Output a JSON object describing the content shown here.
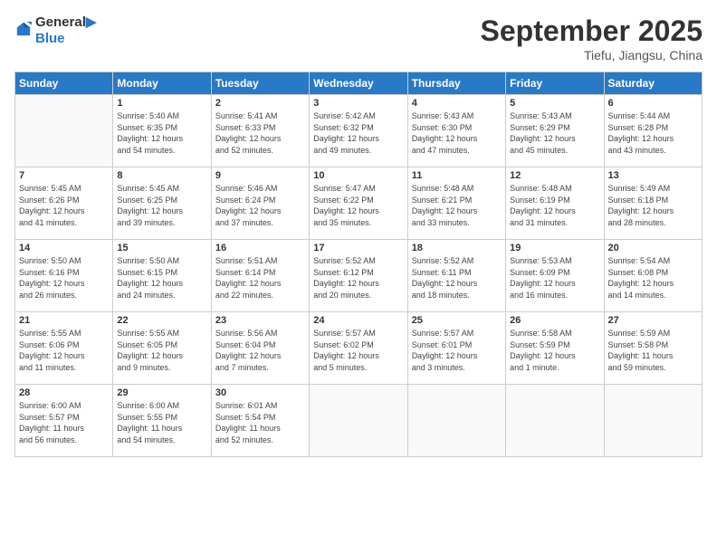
{
  "logo": {
    "line1": "General",
    "line2": "Blue"
  },
  "title": "September 2025",
  "subtitle": "Tiefu, Jiangsu, China",
  "weekdays": [
    "Sunday",
    "Monday",
    "Tuesday",
    "Wednesday",
    "Thursday",
    "Friday",
    "Saturday"
  ],
  "weeks": [
    [
      {
        "day": "",
        "info": ""
      },
      {
        "day": "1",
        "info": "Sunrise: 5:40 AM\nSunset: 6:35 PM\nDaylight: 12 hours\nand 54 minutes."
      },
      {
        "day": "2",
        "info": "Sunrise: 5:41 AM\nSunset: 6:33 PM\nDaylight: 12 hours\nand 52 minutes."
      },
      {
        "day": "3",
        "info": "Sunrise: 5:42 AM\nSunset: 6:32 PM\nDaylight: 12 hours\nand 49 minutes."
      },
      {
        "day": "4",
        "info": "Sunrise: 5:43 AM\nSunset: 6:30 PM\nDaylight: 12 hours\nand 47 minutes."
      },
      {
        "day": "5",
        "info": "Sunrise: 5:43 AM\nSunset: 6:29 PM\nDaylight: 12 hours\nand 45 minutes."
      },
      {
        "day": "6",
        "info": "Sunrise: 5:44 AM\nSunset: 6:28 PM\nDaylight: 12 hours\nand 43 minutes."
      }
    ],
    [
      {
        "day": "7",
        "info": "Sunrise: 5:45 AM\nSunset: 6:26 PM\nDaylight: 12 hours\nand 41 minutes."
      },
      {
        "day": "8",
        "info": "Sunrise: 5:45 AM\nSunset: 6:25 PM\nDaylight: 12 hours\nand 39 minutes."
      },
      {
        "day": "9",
        "info": "Sunrise: 5:46 AM\nSunset: 6:24 PM\nDaylight: 12 hours\nand 37 minutes."
      },
      {
        "day": "10",
        "info": "Sunrise: 5:47 AM\nSunset: 6:22 PM\nDaylight: 12 hours\nand 35 minutes."
      },
      {
        "day": "11",
        "info": "Sunrise: 5:48 AM\nSunset: 6:21 PM\nDaylight: 12 hours\nand 33 minutes."
      },
      {
        "day": "12",
        "info": "Sunrise: 5:48 AM\nSunset: 6:19 PM\nDaylight: 12 hours\nand 31 minutes."
      },
      {
        "day": "13",
        "info": "Sunrise: 5:49 AM\nSunset: 6:18 PM\nDaylight: 12 hours\nand 28 minutes."
      }
    ],
    [
      {
        "day": "14",
        "info": "Sunrise: 5:50 AM\nSunset: 6:16 PM\nDaylight: 12 hours\nand 26 minutes."
      },
      {
        "day": "15",
        "info": "Sunrise: 5:50 AM\nSunset: 6:15 PM\nDaylight: 12 hours\nand 24 minutes."
      },
      {
        "day": "16",
        "info": "Sunrise: 5:51 AM\nSunset: 6:14 PM\nDaylight: 12 hours\nand 22 minutes."
      },
      {
        "day": "17",
        "info": "Sunrise: 5:52 AM\nSunset: 6:12 PM\nDaylight: 12 hours\nand 20 minutes."
      },
      {
        "day": "18",
        "info": "Sunrise: 5:52 AM\nSunset: 6:11 PM\nDaylight: 12 hours\nand 18 minutes."
      },
      {
        "day": "19",
        "info": "Sunrise: 5:53 AM\nSunset: 6:09 PM\nDaylight: 12 hours\nand 16 minutes."
      },
      {
        "day": "20",
        "info": "Sunrise: 5:54 AM\nSunset: 6:08 PM\nDaylight: 12 hours\nand 14 minutes."
      }
    ],
    [
      {
        "day": "21",
        "info": "Sunrise: 5:55 AM\nSunset: 6:06 PM\nDaylight: 12 hours\nand 11 minutes."
      },
      {
        "day": "22",
        "info": "Sunrise: 5:55 AM\nSunset: 6:05 PM\nDaylight: 12 hours\nand 9 minutes."
      },
      {
        "day": "23",
        "info": "Sunrise: 5:56 AM\nSunset: 6:04 PM\nDaylight: 12 hours\nand 7 minutes."
      },
      {
        "day": "24",
        "info": "Sunrise: 5:57 AM\nSunset: 6:02 PM\nDaylight: 12 hours\nand 5 minutes."
      },
      {
        "day": "25",
        "info": "Sunrise: 5:57 AM\nSunset: 6:01 PM\nDaylight: 12 hours\nand 3 minutes."
      },
      {
        "day": "26",
        "info": "Sunrise: 5:58 AM\nSunset: 5:59 PM\nDaylight: 12 hours\nand 1 minute."
      },
      {
        "day": "27",
        "info": "Sunrise: 5:59 AM\nSunset: 5:58 PM\nDaylight: 11 hours\nand 59 minutes."
      }
    ],
    [
      {
        "day": "28",
        "info": "Sunrise: 6:00 AM\nSunset: 5:57 PM\nDaylight: 11 hours\nand 56 minutes."
      },
      {
        "day": "29",
        "info": "Sunrise: 6:00 AM\nSunset: 5:55 PM\nDaylight: 11 hours\nand 54 minutes."
      },
      {
        "day": "30",
        "info": "Sunrise: 6:01 AM\nSunset: 5:54 PM\nDaylight: 11 hours\nand 52 minutes."
      },
      {
        "day": "",
        "info": ""
      },
      {
        "day": "",
        "info": ""
      },
      {
        "day": "",
        "info": ""
      },
      {
        "day": "",
        "info": ""
      }
    ]
  ]
}
